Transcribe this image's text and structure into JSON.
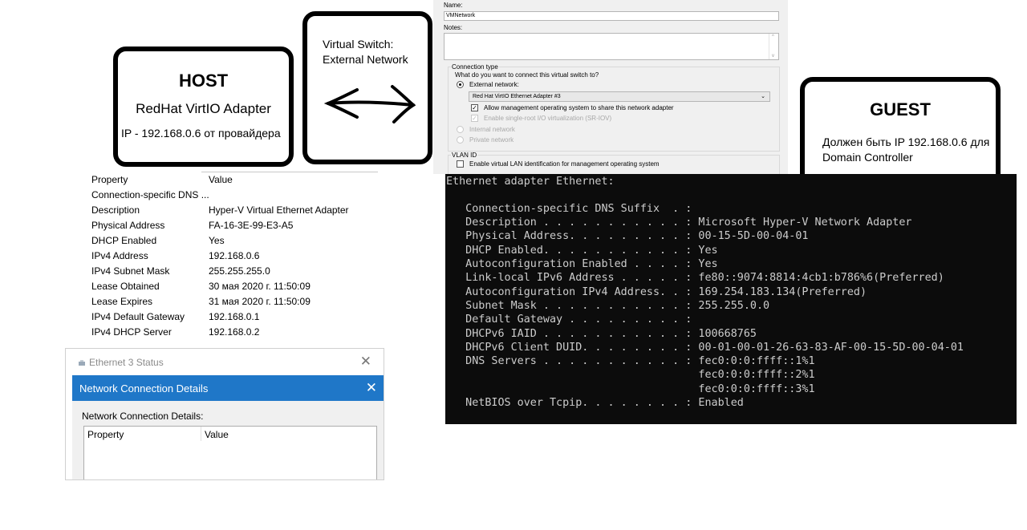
{
  "host": {
    "title": "HOST",
    "adapter": "RedHat VirtIO Adapter",
    "ip": "IP - 192.168.0.6 от провайдера"
  },
  "virtual_switch": {
    "text": "Virtual Switch:\nExternal Network",
    "arrow": "bidirectional-arrow"
  },
  "guest": {
    "title": "GUEST",
    "text": "Должен быть IP 192.168.0.6 для Domain Controller"
  },
  "switch_dialog": {
    "name_label": "Name:",
    "name_value": "VMNetwork",
    "notes_label": "Notes:",
    "connection_type_label": "Connection type",
    "question": "What do you want to connect this virtual switch to?",
    "external_label": "External network:",
    "external_selected": true,
    "adapter_value": "Red Hat VirtIO Ethernet Adapter #3",
    "allow_mgmt_label": "Allow management operating system to share this network adapter",
    "allow_mgmt_checked": true,
    "sriov_label": "Enable single-root I/O virtualization (SR-IOV)",
    "internal_label": "Internal network",
    "private_label": "Private network",
    "vlan_label": "VLAN ID",
    "vlan_check_label": "Enable virtual LAN identification for management operating system",
    "vlan_checked": false
  },
  "host_properties": {
    "columns": [
      "Property",
      "Value"
    ],
    "rows": [
      [
        "Connection-specific DNS ...",
        ""
      ],
      [
        "Description",
        "Hyper-V Virtual Ethernet Adapter"
      ],
      [
        "Physical Address",
        "FA-16-3E-99-E3-A5"
      ],
      [
        "DHCP Enabled",
        "Yes"
      ],
      [
        "IPv4 Address",
        "192.168.0.6"
      ],
      [
        "IPv4 Subnet Mask",
        "255.255.255.0"
      ],
      [
        "Lease Obtained",
        "30 мая 2020 г. 11:50:09"
      ],
      [
        "Lease Expires",
        "31 мая 2020 г. 11:50:09"
      ],
      [
        "IPv4 Default Gateway",
        "192.168.0.1"
      ],
      [
        "IPv4 DHCP Server",
        "192.168.0.2"
      ]
    ]
  },
  "ethernet_status": {
    "title": "Ethernet 3 Status",
    "dialog_title": "Network Connection Details",
    "body_label": "Network Connection Details:",
    "col_property": "Property",
    "col_value": "Value",
    "close_glyph": "✕"
  },
  "console": {
    "lines": [
      "Ethernet adapter Ethernet:",
      "",
      "   Connection-specific DNS Suffix  . :",
      "   Description . . . . . . . . . . . : Microsoft Hyper-V Network Adapter",
      "   Physical Address. . . . . . . . . : 00-15-5D-00-04-01",
      "   DHCP Enabled. . . . . . . . . . . : Yes",
      "   Autoconfiguration Enabled . . . . : Yes",
      "   Link-local IPv6 Address . . . . . : fe80::9074:8814:4cb1:b786%6(Preferred)",
      "   Autoconfiguration IPv4 Address. . : 169.254.183.134(Preferred)",
      "   Subnet Mask . . . . . . . . . . . : 255.255.0.0",
      "   Default Gateway . . . . . . . . . :",
      "   DHCPv6 IAID . . . . . . . . . . . : 100668765",
      "   DHCPv6 Client DUID. . . . . . . . : 00-01-00-01-26-63-83-AF-00-15-5D-00-04-01",
      "   DNS Servers . . . . . . . . . . . : fec0:0:0:ffff::1%1",
      "                                       fec0:0:0:ffff::2%1",
      "                                       fec0:0:0:ffff::3%1",
      "   NetBIOS over Tcpip. . . . . . . . : Enabled"
    ]
  }
}
